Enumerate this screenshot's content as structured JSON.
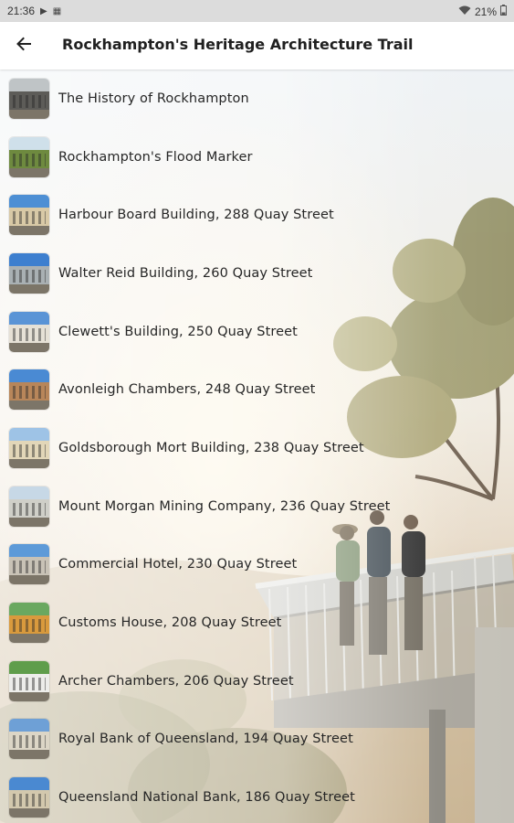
{
  "status_bar": {
    "time": "21:36",
    "left_icons": [
      "play-icon",
      "notification-icon"
    ],
    "battery": "21%",
    "right_icons": [
      "wifi-icon",
      "battery-icon"
    ]
  },
  "app_bar": {
    "back_icon": "arrow-back-icon",
    "title": "Rockhampton's Heritage Architecture Trail"
  },
  "trail_items": [
    {
      "label": "The History of Rockhampton",
      "thumb_colors": [
        "#bfc4c6",
        "#5d5c58"
      ]
    },
    {
      "label": "Rockhampton's Flood Marker",
      "thumb_colors": [
        "#cfe0ea",
        "#6e8a3f"
      ]
    },
    {
      "label": "Harbour Board Building, 288 Quay Street",
      "thumb_colors": [
        "#4d8fd4",
        "#d8c9a6"
      ]
    },
    {
      "label": "Walter Reid Building, 260 Quay Street",
      "thumb_colors": [
        "#3d7fcf",
        "#a9b0b3"
      ]
    },
    {
      "label": "Clewett's Building, 250 Quay Street",
      "thumb_colors": [
        "#5a94d6",
        "#e6e1d6"
      ]
    },
    {
      "label": "Avonleigh Chambers, 248 Quay Street",
      "thumb_colors": [
        "#4a8ad3",
        "#b8865a"
      ]
    },
    {
      "label": "Goldsborough Mort Building, 238 Quay Street",
      "thumb_colors": [
        "#9ec3e6",
        "#e2d6b8"
      ]
    },
    {
      "label": "Mount Morgan Mining Company, 236 Quay Street",
      "thumb_colors": [
        "#c7d8e6",
        "#cfcfc8"
      ]
    },
    {
      "label": "Commercial Hotel, 230 Quay Street",
      "thumb_colors": [
        "#5d9ad8",
        "#c8c2b6"
      ]
    },
    {
      "label": "Customs House, 208 Quay Street",
      "thumb_colors": [
        "#6aa860",
        "#d99a3d"
      ]
    },
    {
      "label": "Archer Chambers, 206 Quay Street",
      "thumb_colors": [
        "#5f9d4b",
        "#ededea"
      ]
    },
    {
      "label": "Royal Bank of Queensland, 194 Quay Street",
      "thumb_colors": [
        "#6ea0d6",
        "#dcd6c6"
      ]
    },
    {
      "label": "Queensland National Bank, 186 Quay Street",
      "thumb_colors": [
        "#4a89d1",
        "#d3c8ad"
      ]
    }
  ]
}
